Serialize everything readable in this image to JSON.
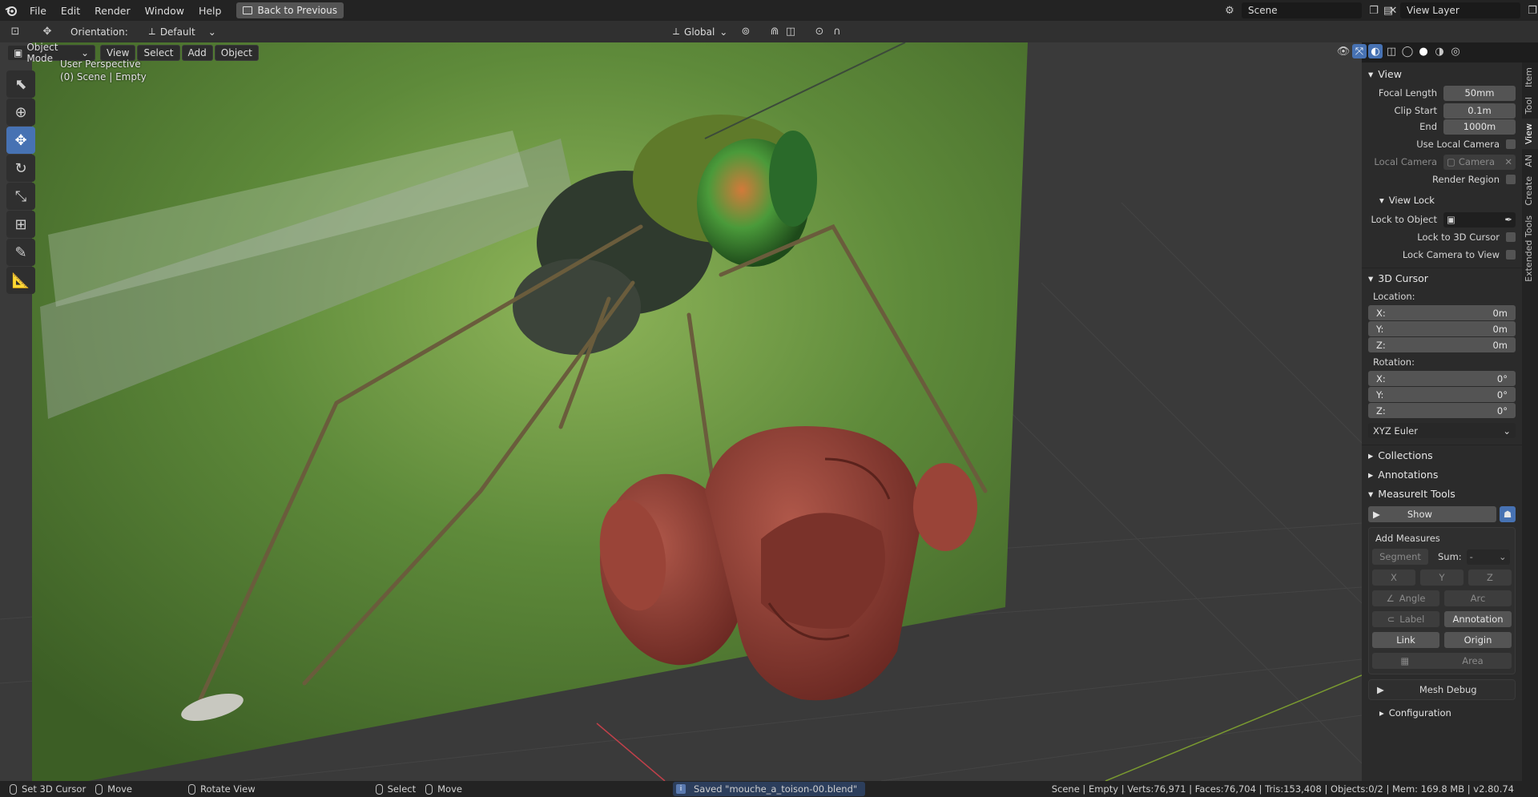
{
  "topbar": {
    "menus": [
      "File",
      "Edit",
      "Render",
      "Window",
      "Help"
    ],
    "back_button": "Back to Previous",
    "scene_name": "Scene",
    "view_layer": "View Layer"
  },
  "header": {
    "orientation_label": "Orientation:",
    "orientation_value": "Default",
    "transform_space": "Global"
  },
  "viewport_header": {
    "mode": "Object Mode",
    "menus": [
      "View",
      "Select",
      "Add",
      "Object"
    ]
  },
  "viewport": {
    "perspective": "User Perspective",
    "scene_info": "(0) Scene | Empty"
  },
  "npanel": {
    "view": {
      "title": "View",
      "focal_length_label": "Focal Length",
      "focal_length": "50mm",
      "clip_start_label": "Clip Start",
      "clip_start": "0.1m",
      "end_label": "End",
      "end": "1000m",
      "use_local_camera": "Use Local Camera",
      "local_camera_label": "Local Camera",
      "local_camera_value": "Camera",
      "render_region": "Render Region"
    },
    "view_lock": {
      "title": "View Lock",
      "lock_to_object": "Lock to Object",
      "lock_to_3d_cursor": "Lock to 3D Cursor",
      "lock_camera_to_view": "Lock Camera to View"
    },
    "cursor": {
      "title": "3D Cursor",
      "location_label": "Location:",
      "location": [
        {
          "axis": "X:",
          "value": "0m"
        },
        {
          "axis": "Y:",
          "value": "0m"
        },
        {
          "axis": "Z:",
          "value": "0m"
        }
      ],
      "rotation_label": "Rotation:",
      "rotation": [
        {
          "axis": "X:",
          "value": "0°"
        },
        {
          "axis": "Y:",
          "value": "0°"
        },
        {
          "axis": "Z:",
          "value": "0°"
        }
      ],
      "rotation_mode": "XYZ Euler"
    },
    "collections": "Collections",
    "annotations": "Annotations",
    "measureit": {
      "title": "MeasureIt Tools",
      "show": "Show",
      "add_measures": "Add Measures",
      "segment": "Segment",
      "sum_label": "Sum:",
      "sum_value": "-",
      "x": "X",
      "y": "Y",
      "z": "Z",
      "angle": "Angle",
      "arc": "Arc",
      "label": "Label",
      "annotation": "Annotation",
      "link": "Link",
      "origin": "Origin",
      "area": "Area",
      "mesh_debug": "Mesh Debug",
      "configuration": "Configuration"
    },
    "tabs": [
      "Item",
      "Tool",
      "View",
      "AN",
      "Create",
      "Extended Tools"
    ]
  },
  "statusbar": {
    "set_cursor": "Set 3D Cursor",
    "move": "Move",
    "rotate_view": "Rotate View",
    "select": "Select",
    "move2": "Move",
    "saved_msg": "Saved \"mouche_a_toison-00.blend\"",
    "stats": "Scene | Empty | Verts:76,971 | Faces:76,704 | Tris:153,408 | Objects:0/2 | Mem: 169.8 MB | v2.80.74"
  }
}
